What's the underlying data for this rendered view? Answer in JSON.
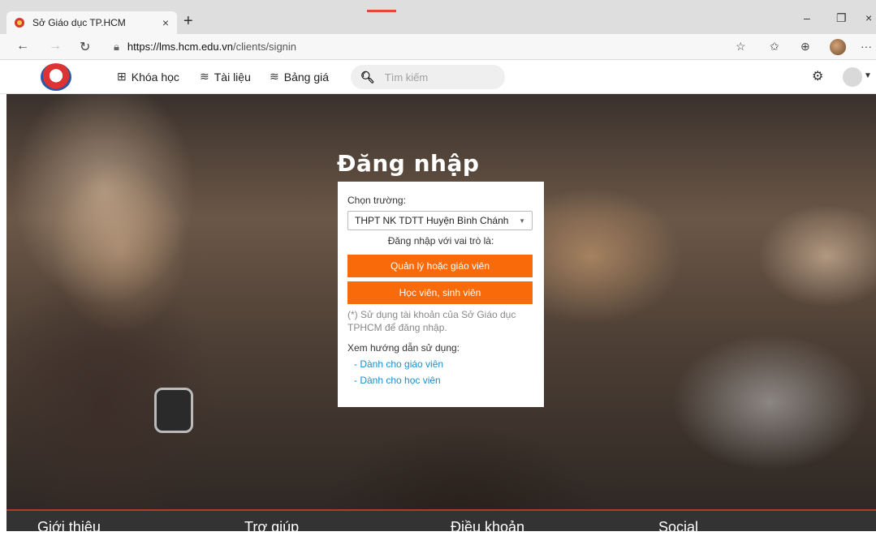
{
  "browser": {
    "tab_title": "Sở Giáo dục TP.HCM",
    "tab_close": "×",
    "new_tab": "+",
    "url_host": "https://lms.hcm.edu.vn",
    "url_path": "/clients/signin",
    "win_min": "–",
    "win_restore": "❐",
    "win_close": "×",
    "more": "···"
  },
  "header": {
    "menu": [
      {
        "icon": "grid-icon",
        "glyph": "⊞",
        "label": "Khóa học"
      },
      {
        "icon": "layers-icon",
        "glyph": "≋",
        "label": "Tài liệu"
      },
      {
        "icon": "layers-icon",
        "glyph": "≋",
        "label": "Bảng giá"
      }
    ],
    "search_placeholder": "Tìm kiếm"
  },
  "signin": {
    "title": "Đăng nhập",
    "school_label": "Chọn trường:",
    "school_selected": "THPT NK TDTT Huyện Bình Chánh",
    "role_prompt": "Đăng nhập với vai trò là:",
    "btn_teacher": "Quản lý hoặc giáo viên",
    "btn_student": "Học viên, sinh viên",
    "note": "(*) Sử dụng tài khoản của Sở Giáo dục TPHCM để đăng nhập.",
    "guide_label": "Xem hướng dẫn sử dụng:",
    "guide_teacher": "- Dành cho giáo viên",
    "guide_student": "- Dành cho học viên"
  },
  "footer": {
    "col1": "Giới thiệu",
    "col2": "Trợ giúp",
    "col3": "Điều khoản",
    "col4": "Social"
  },
  "colors": {
    "accent": "#f96a0a",
    "link": "#1a8fcf",
    "footer": "#333333"
  }
}
